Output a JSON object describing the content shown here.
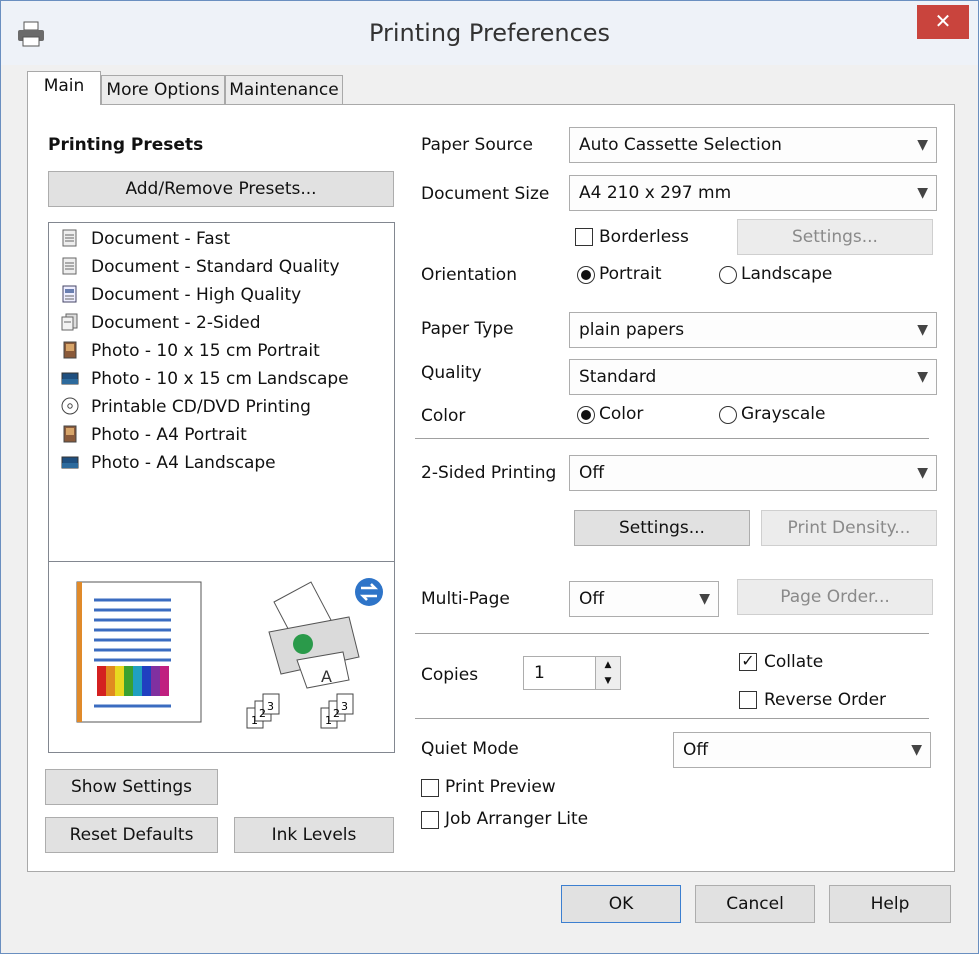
{
  "window": {
    "title": "Printing Preferences",
    "close_glyph": "✕"
  },
  "tabs": [
    {
      "label": "Main",
      "active": true
    },
    {
      "label": "More Options",
      "active": false
    },
    {
      "label": "Maintenance",
      "active": false
    }
  ],
  "presets": {
    "heading": "Printing Presets",
    "add_remove_label": "Add/Remove Presets...",
    "items": [
      {
        "label": "Document - Fast",
        "icon": "document-icon"
      },
      {
        "label": "Document - Standard Quality",
        "icon": "document-icon"
      },
      {
        "label": "Document - High Quality",
        "icon": "document-high-icon"
      },
      {
        "label": "Document - 2-Sided",
        "icon": "document-2sided-icon"
      },
      {
        "label": "Photo - 10 x 15 cm Portrait",
        "icon": "photo-portrait-icon"
      },
      {
        "label": "Photo - 10 x 15 cm Landscape",
        "icon": "photo-landscape-icon"
      },
      {
        "label": "Printable CD/DVD Printing",
        "icon": "cd-icon"
      },
      {
        "label": "Photo - A4 Portrait",
        "icon": "photo-portrait-icon"
      },
      {
        "label": "Photo - A4 Landscape",
        "icon": "photo-landscape-icon"
      }
    ]
  },
  "preview": {
    "page_digits": [
      "1",
      "2",
      "3"
    ]
  },
  "left_buttons": {
    "show_settings": "Show Settings",
    "reset_defaults": "Reset Defaults",
    "ink_levels": "Ink Levels"
  },
  "settings": {
    "paper_source": {
      "label": "Paper Source",
      "value": "Auto Cassette Selection"
    },
    "document_size": {
      "label": "Document Size",
      "value": "A4 210 x 297 mm"
    },
    "borderless": {
      "label": "Borderless",
      "checked": false
    },
    "borderless_settings": "Settings...",
    "orientation": {
      "label": "Orientation",
      "portrait": "Portrait",
      "landscape": "Landscape",
      "selected": "Portrait"
    },
    "paper_type": {
      "label": "Paper Type",
      "value": "plain papers"
    },
    "quality": {
      "label": "Quality",
      "value": "Standard"
    },
    "color": {
      "label": "Color",
      "color": "Color",
      "grayscale": "Grayscale",
      "selected": "Color"
    },
    "two_sided": {
      "label": "2-Sided Printing",
      "value": "Off"
    },
    "two_sided_settings": "Settings...",
    "print_density": "Print Density...",
    "multi_page": {
      "label": "Multi-Page",
      "value": "Off"
    },
    "page_order": "Page Order...",
    "copies": {
      "label": "Copies",
      "value": "1"
    },
    "collate": {
      "label": "Collate",
      "checked": true
    },
    "reverse_order": {
      "label": "Reverse Order",
      "checked": false
    },
    "quiet_mode": {
      "label": "Quiet Mode",
      "value": "Off"
    },
    "print_preview": {
      "label": "Print Preview",
      "checked": false
    },
    "job_arranger": {
      "label": "Job Arranger Lite",
      "checked": false
    }
  },
  "footer": {
    "ok": "OK",
    "cancel": "Cancel",
    "help": "Help"
  },
  "colors": {
    "close": "#c9443d",
    "accent_blue": "#1f6fc2",
    "title_bg": "#eef2f8"
  }
}
